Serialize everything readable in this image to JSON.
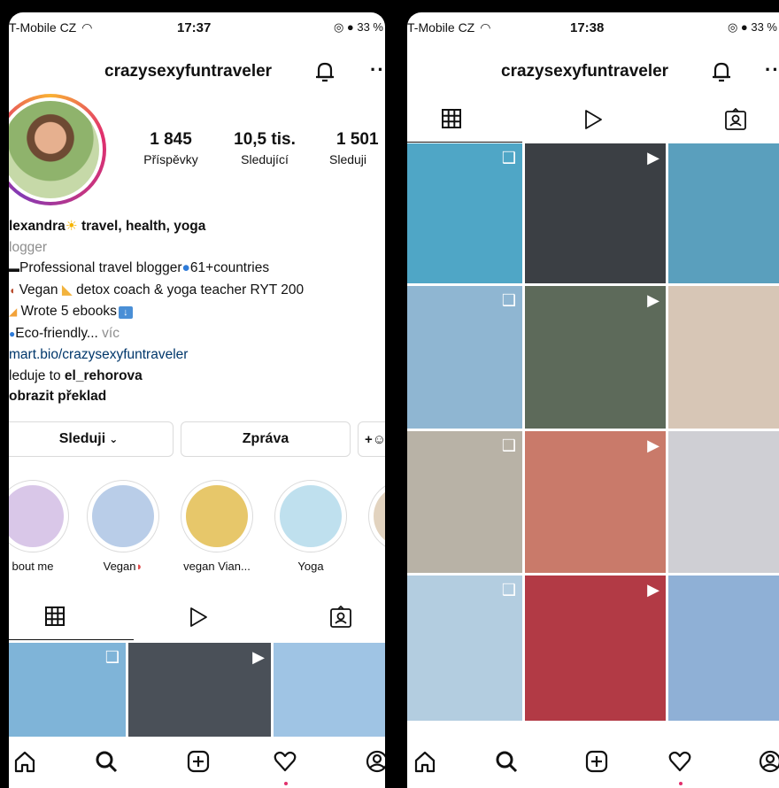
{
  "left_screen": {
    "status": {
      "carrier": "T-Mobile CZ",
      "time": "17:37",
      "battery": "33 %"
    },
    "username": "crazysexyfuntraveler",
    "stats": [
      {
        "value": "1 845",
        "label": "Příspěvky"
      },
      {
        "value": "10,5 tis.",
        "label": "Sledující"
      },
      {
        "value": "1 501",
        "label": "Sleduji"
      }
    ],
    "bio": {
      "name": "lexandra",
      "name_suffix": "travel, health, yoga",
      "category": "logger",
      "line1": "Professional travel blogger",
      "line1_suffix": "61+countries",
      "line2_a": "Vegan",
      "line2_b": "detox coach & yoga teacher RYT 200",
      "line3": "Wrote 5 ebooks",
      "line4": "Eco-friendly...",
      "more": "víc",
      "link": "mart.bio/crazysexyfuntraveler",
      "followed_by_prefix": "leduje to",
      "followed_by_user": "el_rehorova",
      "translate": "obrazit překlad"
    },
    "buttons": {
      "follow": "Sleduji",
      "message": "Zpráva"
    },
    "highlights": [
      {
        "label": "bout me",
        "color": "#d9c7e8"
      },
      {
        "label": "Vegan",
        "color": "#b9cde8"
      },
      {
        "label": "vegan Vian...",
        "color": "#e7c76a"
      },
      {
        "label": "Yoga",
        "color": "#bfe0ee"
      }
    ],
    "grid_top": [
      {
        "color": "#7fb4d8",
        "icon": "multi"
      },
      {
        "color": "#4a5058",
        "icon": "reel"
      },
      {
        "color": "#9fc4e4",
        "icon": ""
      }
    ]
  },
  "right_screen": {
    "status": {
      "carrier": "T-Mobile CZ",
      "time": "17:38",
      "battery": "33 %"
    },
    "username": "crazysexyfuntraveler",
    "grid": [
      {
        "color": "#4fa6c6",
        "icon": "multi"
      },
      {
        "color": "#3b3f44",
        "icon": "reel"
      },
      {
        "color": "#5a9fbd",
        "icon": ""
      },
      {
        "color": "#8fb6d2",
        "icon": "multi"
      },
      {
        "color": "#5d6a5a",
        "icon": "reel"
      },
      {
        "color": "#d7c6b6",
        "icon": ""
      },
      {
        "color": "#b8b2a6",
        "icon": "multi"
      },
      {
        "color": "#c97a6a",
        "icon": "reel"
      },
      {
        "color": "#cfcfd4",
        "icon": ""
      },
      {
        "color": "#b3cde0",
        "icon": "multi"
      },
      {
        "color": "#b23a45",
        "icon": "reel"
      },
      {
        "color": "#8fb0d6",
        "icon": ""
      }
    ]
  }
}
